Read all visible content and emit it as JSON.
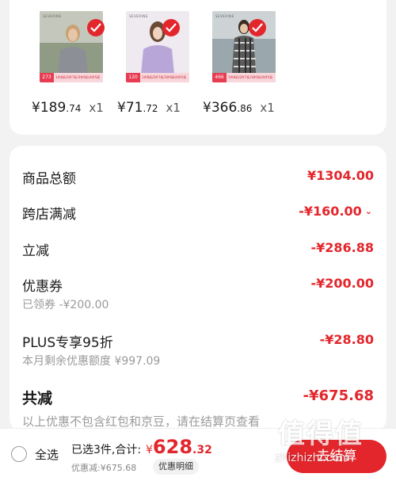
{
  "products": [
    {
      "brand": "SEVERINE",
      "promo_tag": "273",
      "promo_text": "1件8折/2件7折/3件6折/4件5折",
      "price_int": "¥189",
      "price_dec": ".74",
      "qty": "x1",
      "colors": {
        "bg1": "#7d8a70",
        "bg2": "#c6c9bb",
        "cloth": "#8c8f95",
        "hair": "#c9a173"
      }
    },
    {
      "brand": "SEVERINE",
      "promo_tag": "120",
      "promo_text": "1件8折/2件7折/3件6折/4件5折",
      "price_int": "¥71",
      "price_dec": ".72",
      "qty": "x1",
      "colors": {
        "bg1": "#ece8ee",
        "bg2": "#f3f1f4",
        "cloth": "#b8a6d8",
        "hair": "#6a4a35"
      }
    },
    {
      "brand": "SEVERINE",
      "promo_tag": "466",
      "promo_text": "1件8折/2件7折/3件6折/4件5折",
      "price_int": "¥366",
      "price_dec": ".86",
      "qty": "x1",
      "colors": {
        "bg1": "#8fa0a6",
        "bg2": "#c9cfd1",
        "cloth": "#4a4a4a",
        "hair": "#3b2a22"
      }
    }
  ],
  "summary": {
    "goods_total": {
      "label": "商品总额",
      "value": "¥1304.00"
    },
    "cross_store": {
      "label": "跨店满减",
      "value": "-¥160.00"
    },
    "instant": {
      "label": "立减",
      "value": "-¥286.88"
    },
    "coupon": {
      "label": "优惠券",
      "value": "-¥200.00",
      "sub": "已领券 -¥200.00"
    },
    "plus": {
      "label": "PLUS专享95折",
      "value": "-¥28.80",
      "sub": "本月剩余优惠额度 ¥997.09"
    },
    "total_discount": {
      "label": "共减",
      "value": "-¥675.68"
    },
    "note": "以上优惠不包含红包和京豆，请在结算页查看"
  },
  "bottom": {
    "select_all": "全选",
    "selected_text": "已选3件,合计:",
    "total_cur": "¥",
    "total_int": "628",
    "total_dec": ".32",
    "discount_text": "优惠减:¥675.68",
    "detail_label": "优惠明细",
    "checkout_label": "去结算"
  },
  "watermark": {
    "logo": "值得值",
    "url": "zhizhizhi.com"
  },
  "accent": "#e3262c"
}
